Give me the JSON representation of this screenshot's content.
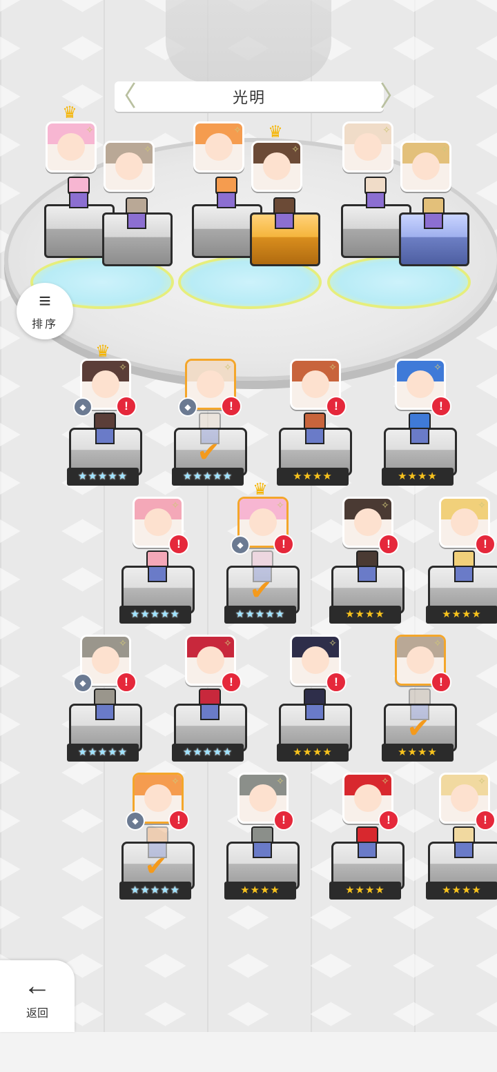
{
  "header": {
    "title": "光明",
    "left_cap": "〈",
    "right_cap": "〉"
  },
  "sort_button": {
    "label": "排序",
    "icon": "sort-icon"
  },
  "back_button": {
    "label": "返回",
    "icon": "arrow-left-icon"
  },
  "team_slots": [
    {
      "members": [
        {
          "icon": "crown-icon",
          "portrait_color": "#f7b6d2",
          "pedestal": "gray",
          "crowned": true
        },
        {
          "portrait_color": "#b9a896",
          "pedestal": "gray"
        }
      ]
    },
    {
      "members": [
        {
          "portrait_color": "#f59c4f",
          "pedestal": "gray"
        },
        {
          "portrait_color": "#6b4a36",
          "pedestal": "gold",
          "crowned": true
        }
      ]
    },
    {
      "members": [
        {
          "portrait_color": "#f0dcc8",
          "pedestal": "gray"
        },
        {
          "portrait_color": "#e3c07a",
          "pedestal": "blue"
        }
      ]
    }
  ],
  "roster_symbols": {
    "star": "★",
    "alert": "!",
    "check": "✔",
    "sparkle": "✧",
    "crown": "♛",
    "gem": "◆"
  },
  "roster": [
    {
      "stars": "★★★★★",
      "rainbow": true,
      "portrait_color": "#5b3e38",
      "crowned": true,
      "gem": true,
      "selected": false,
      "checked": false
    },
    {
      "stars": "★★★★★",
      "rainbow": true,
      "portrait_color": "#f0dcc8",
      "gem": true,
      "selected": true,
      "checked": true
    },
    {
      "stars": "★★★★",
      "rainbow": false,
      "portrait_color": "#c8643c",
      "selected": false,
      "checked": false
    },
    {
      "stars": "★★★★",
      "rainbow": false,
      "portrait_color": "#3f7ad8",
      "selected": false,
      "checked": false
    },
    {
      "stars": "★★★★★",
      "rainbow": true,
      "portrait_color": "#f4a8b8",
      "selected": false,
      "checked": false
    },
    {
      "stars": "★★★★★",
      "rainbow": true,
      "portrait_color": "#f7b6d2",
      "crowned": true,
      "gem": true,
      "selected": true,
      "checked": true
    },
    {
      "stars": "★★★★",
      "rainbow": false,
      "portrait_color": "#4a3a33",
      "selected": false,
      "checked": false
    },
    {
      "stars": "★★★★",
      "rainbow": false,
      "portrait_color": "#f1d07a",
      "selected": false,
      "checked": false
    },
    {
      "stars": "★★★★★",
      "rainbow": true,
      "portrait_color": "#9a968c",
      "gem": true,
      "selected": false,
      "checked": false
    },
    {
      "stars": "★★★★★",
      "rainbow": true,
      "portrait_color": "#c8283c",
      "selected": false,
      "checked": false
    },
    {
      "stars": "★★★★",
      "rainbow": false,
      "portrait_color": "#2e2e4a",
      "selected": false,
      "checked": false
    },
    {
      "stars": "★★★★",
      "rainbow": false,
      "portrait_color": "#b9a896",
      "selected": true,
      "checked": true
    },
    {
      "stars": "★★★★★",
      "rainbow": true,
      "portrait_color": "#f59c4f",
      "gem": true,
      "selected": true,
      "checked": true
    },
    {
      "stars": "★★★★",
      "rainbow": false,
      "portrait_color": "#8b8f8a",
      "selected": false,
      "checked": false
    },
    {
      "stars": "★★★★",
      "rainbow": false,
      "portrait_color": "#d8282e",
      "selected": false,
      "checked": false
    },
    {
      "stars": "★★★★",
      "rainbow": false,
      "portrait_color": "#f1d9a0",
      "selected": false,
      "checked": false
    }
  ]
}
